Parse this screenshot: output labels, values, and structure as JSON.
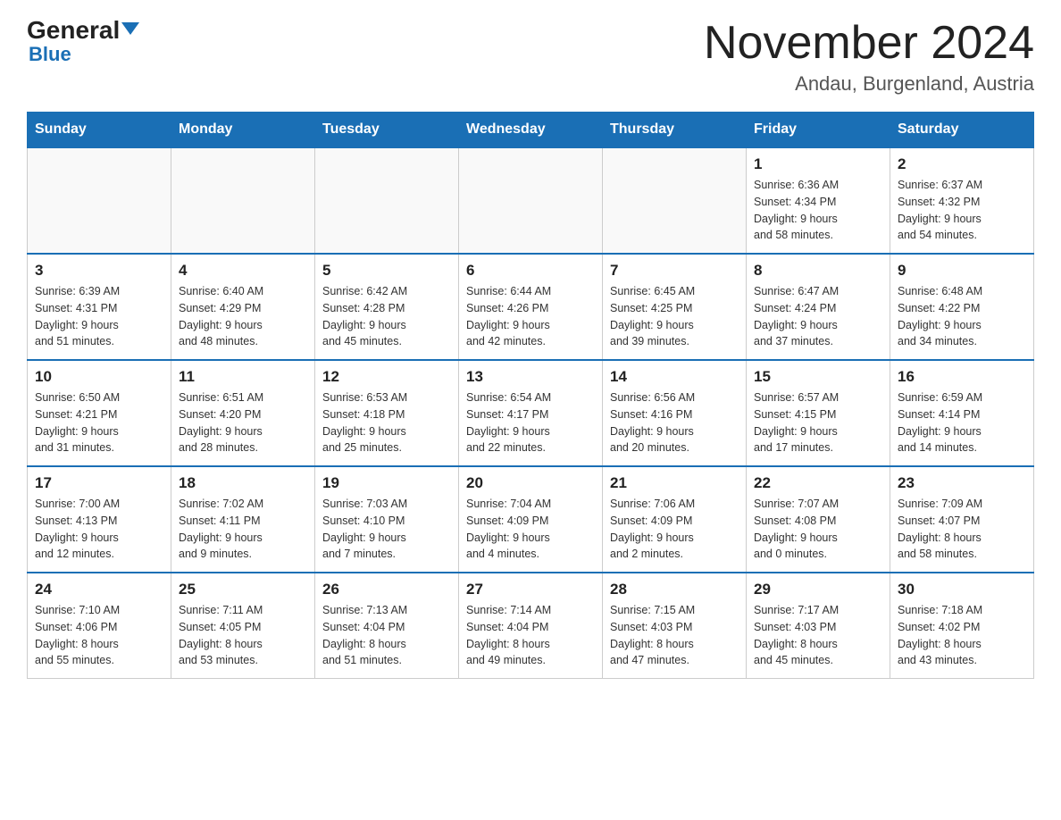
{
  "logo": {
    "name_part1": "General",
    "name_part2": "Blue"
  },
  "header": {
    "title": "November 2024",
    "subtitle": "Andau, Burgenland, Austria"
  },
  "weekdays": [
    "Sunday",
    "Monday",
    "Tuesday",
    "Wednesday",
    "Thursday",
    "Friday",
    "Saturday"
  ],
  "weeks": [
    [
      {
        "day": "",
        "info": ""
      },
      {
        "day": "",
        "info": ""
      },
      {
        "day": "",
        "info": ""
      },
      {
        "day": "",
        "info": ""
      },
      {
        "day": "",
        "info": ""
      },
      {
        "day": "1",
        "info": "Sunrise: 6:36 AM\nSunset: 4:34 PM\nDaylight: 9 hours\nand 58 minutes."
      },
      {
        "day": "2",
        "info": "Sunrise: 6:37 AM\nSunset: 4:32 PM\nDaylight: 9 hours\nand 54 minutes."
      }
    ],
    [
      {
        "day": "3",
        "info": "Sunrise: 6:39 AM\nSunset: 4:31 PM\nDaylight: 9 hours\nand 51 minutes."
      },
      {
        "day": "4",
        "info": "Sunrise: 6:40 AM\nSunset: 4:29 PM\nDaylight: 9 hours\nand 48 minutes."
      },
      {
        "day": "5",
        "info": "Sunrise: 6:42 AM\nSunset: 4:28 PM\nDaylight: 9 hours\nand 45 minutes."
      },
      {
        "day": "6",
        "info": "Sunrise: 6:44 AM\nSunset: 4:26 PM\nDaylight: 9 hours\nand 42 minutes."
      },
      {
        "day": "7",
        "info": "Sunrise: 6:45 AM\nSunset: 4:25 PM\nDaylight: 9 hours\nand 39 minutes."
      },
      {
        "day": "8",
        "info": "Sunrise: 6:47 AM\nSunset: 4:24 PM\nDaylight: 9 hours\nand 37 minutes."
      },
      {
        "day": "9",
        "info": "Sunrise: 6:48 AM\nSunset: 4:22 PM\nDaylight: 9 hours\nand 34 minutes."
      }
    ],
    [
      {
        "day": "10",
        "info": "Sunrise: 6:50 AM\nSunset: 4:21 PM\nDaylight: 9 hours\nand 31 minutes."
      },
      {
        "day": "11",
        "info": "Sunrise: 6:51 AM\nSunset: 4:20 PM\nDaylight: 9 hours\nand 28 minutes."
      },
      {
        "day": "12",
        "info": "Sunrise: 6:53 AM\nSunset: 4:18 PM\nDaylight: 9 hours\nand 25 minutes."
      },
      {
        "day": "13",
        "info": "Sunrise: 6:54 AM\nSunset: 4:17 PM\nDaylight: 9 hours\nand 22 minutes."
      },
      {
        "day": "14",
        "info": "Sunrise: 6:56 AM\nSunset: 4:16 PM\nDaylight: 9 hours\nand 20 minutes."
      },
      {
        "day": "15",
        "info": "Sunrise: 6:57 AM\nSunset: 4:15 PM\nDaylight: 9 hours\nand 17 minutes."
      },
      {
        "day": "16",
        "info": "Sunrise: 6:59 AM\nSunset: 4:14 PM\nDaylight: 9 hours\nand 14 minutes."
      }
    ],
    [
      {
        "day": "17",
        "info": "Sunrise: 7:00 AM\nSunset: 4:13 PM\nDaylight: 9 hours\nand 12 minutes."
      },
      {
        "day": "18",
        "info": "Sunrise: 7:02 AM\nSunset: 4:11 PM\nDaylight: 9 hours\nand 9 minutes."
      },
      {
        "day": "19",
        "info": "Sunrise: 7:03 AM\nSunset: 4:10 PM\nDaylight: 9 hours\nand 7 minutes."
      },
      {
        "day": "20",
        "info": "Sunrise: 7:04 AM\nSunset: 4:09 PM\nDaylight: 9 hours\nand 4 minutes."
      },
      {
        "day": "21",
        "info": "Sunrise: 7:06 AM\nSunset: 4:09 PM\nDaylight: 9 hours\nand 2 minutes."
      },
      {
        "day": "22",
        "info": "Sunrise: 7:07 AM\nSunset: 4:08 PM\nDaylight: 9 hours\nand 0 minutes."
      },
      {
        "day": "23",
        "info": "Sunrise: 7:09 AM\nSunset: 4:07 PM\nDaylight: 8 hours\nand 58 minutes."
      }
    ],
    [
      {
        "day": "24",
        "info": "Sunrise: 7:10 AM\nSunset: 4:06 PM\nDaylight: 8 hours\nand 55 minutes."
      },
      {
        "day": "25",
        "info": "Sunrise: 7:11 AM\nSunset: 4:05 PM\nDaylight: 8 hours\nand 53 minutes."
      },
      {
        "day": "26",
        "info": "Sunrise: 7:13 AM\nSunset: 4:04 PM\nDaylight: 8 hours\nand 51 minutes."
      },
      {
        "day": "27",
        "info": "Sunrise: 7:14 AM\nSunset: 4:04 PM\nDaylight: 8 hours\nand 49 minutes."
      },
      {
        "day": "28",
        "info": "Sunrise: 7:15 AM\nSunset: 4:03 PM\nDaylight: 8 hours\nand 47 minutes."
      },
      {
        "day": "29",
        "info": "Sunrise: 7:17 AM\nSunset: 4:03 PM\nDaylight: 8 hours\nand 45 minutes."
      },
      {
        "day": "30",
        "info": "Sunrise: 7:18 AM\nSunset: 4:02 PM\nDaylight: 8 hours\nand 43 minutes."
      }
    ]
  ]
}
